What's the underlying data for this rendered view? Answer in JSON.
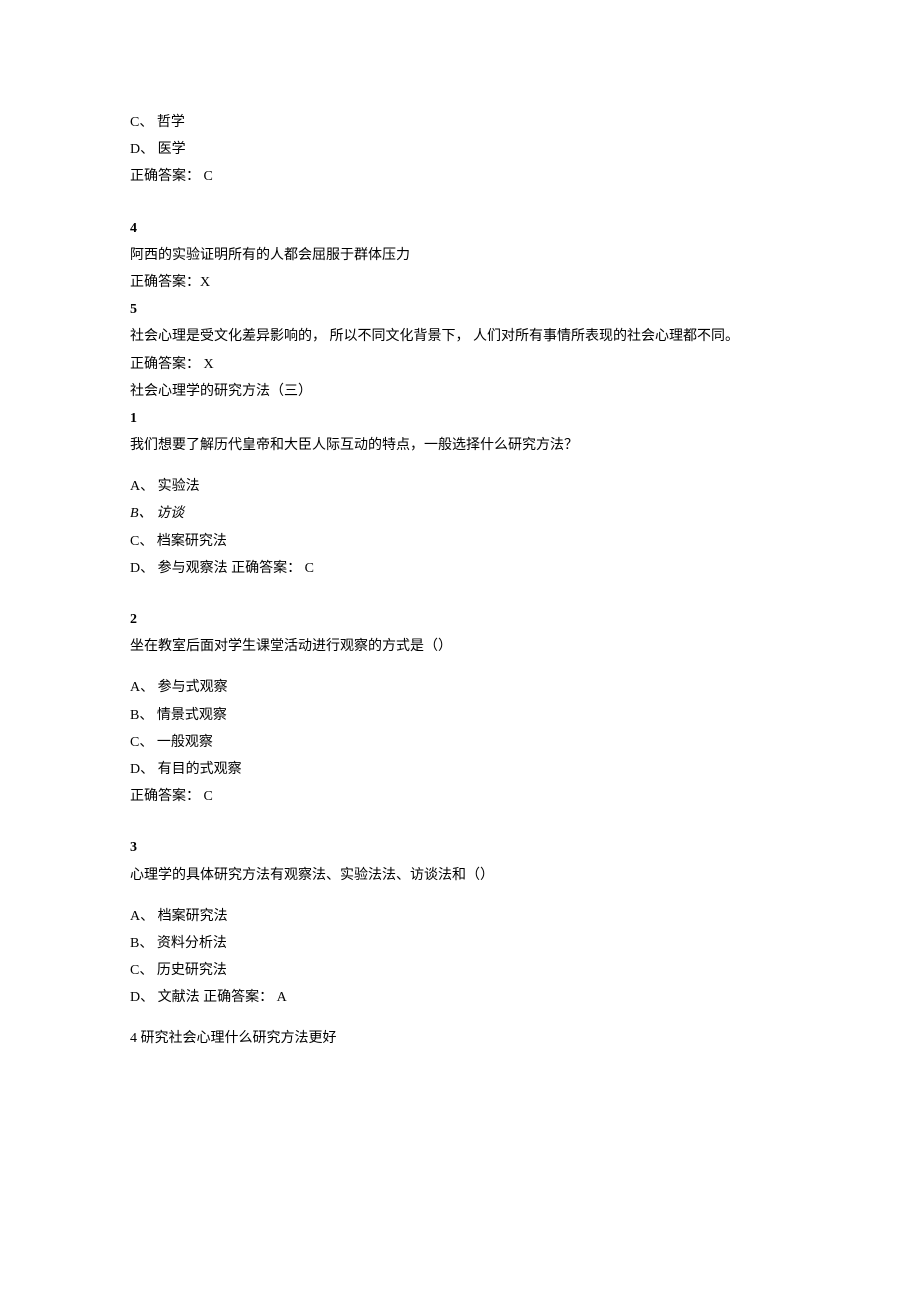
{
  "lines": {
    "l1": "C、 哲学",
    "l2": "D、 医学",
    "l3": "正确答案： C",
    "q4": "4",
    "l4": "阿西的实验证明所有的人都会屈服于群体压力",
    "l5": "正确答案：X",
    "q5": "5",
    "l6": "社会心理是受文化差异影响的，  所以不同文化背景下，  人们对所有事情所表现的社会心理都不同。",
    "l7": "正确答案： X",
    "l8": "社会心理学的研究方法（三）",
    "q1b": "1",
    "l9": "我们想要了解历代皇帝和大臣人际互动的特点，一般选择什么研究方法？",
    "l10": "A、 实验法",
    "l11a": "B、",
    "l11b": "访谈",
    "l12": "C、 档案研究法",
    "l13": "D、 参与观察法 正确答案： C",
    "q2b": "2",
    "l14": "坐在教室后面对学生课堂活动进行观察的方式是（）",
    "l15": "A、 参与式观察",
    "l16": "B、 情景式观察",
    "l17": "C、 一般观察",
    "l18": "D、 有目的式观察",
    "l19": "正确答案： C",
    "q3b": "3",
    "l20": "心理学的具体研究方法有观察法、实验法法、访谈法和（）",
    "l21": "A、 档案研究法",
    "l22": "B、 资料分析法",
    "l23": "C、 历史研究法",
    "l24": "D、 文献法 正确答案： A",
    "q4b": "4 研究社会心理什么研究方法更好"
  }
}
